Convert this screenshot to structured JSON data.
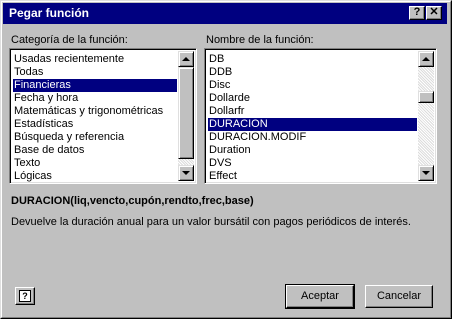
{
  "dialog": {
    "title": "Pegar función",
    "help_glyph": "?",
    "close_glyph": "✕"
  },
  "category": {
    "label": "Categoría de la función:",
    "items": [
      "Usadas recientemente",
      "Todas",
      "Financieras",
      "Fecha y hora",
      "Matemáticas y trigonométricas",
      "Estadísticas",
      "Búsqueda y referencia",
      "Base de datos",
      "Texto",
      "Lógicas"
    ],
    "selected": "Financieras"
  },
  "functions": {
    "label": "Nombre de la función:",
    "items": [
      "DB",
      "DDB",
      "Disc",
      "Dollarde",
      "Dollarfr",
      "DURACION",
      "DURACION.MODIF",
      "Duration",
      "DVS",
      "Effect"
    ],
    "selected": "DURACION"
  },
  "signature": "DURACION(liq,vencto,cupón,rendto,frec,base)",
  "description": "Devuelve la duración anual para  un valor bursátil con pagos periódicos de interés.",
  "buttons": {
    "help_glyph": "?",
    "ok": "Aceptar",
    "cancel": "Cancelar"
  }
}
